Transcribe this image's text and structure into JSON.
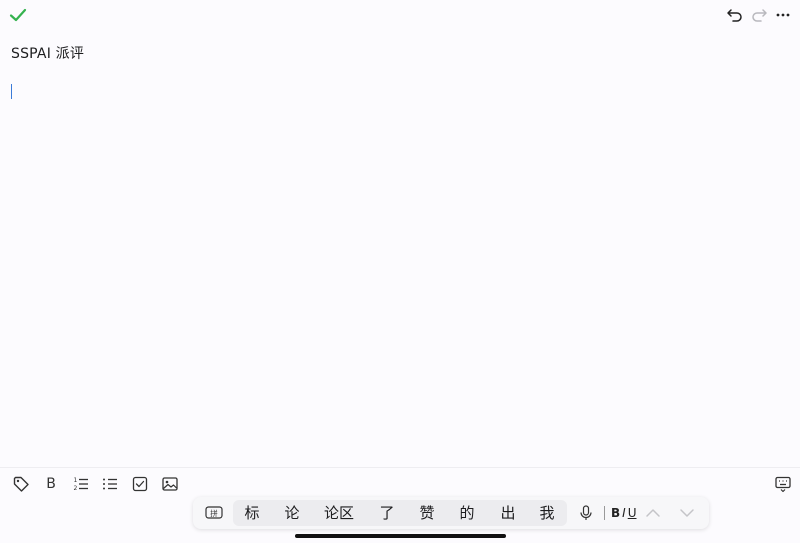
{
  "note": {
    "title": "SSPAI 派评",
    "body": ""
  },
  "toolbar_top": {
    "done_icon": "checkmark-icon",
    "undo_icon": "undo-icon",
    "redo_icon": "redo-icon",
    "more_icon": "more-icon"
  },
  "format_bar": {
    "tag_icon": "tag-icon",
    "bold_label": "B",
    "numbered_list_icon": "numbered-list-icon",
    "bullet_list_icon": "bullet-list-icon",
    "checkbox_icon": "checkbox-icon",
    "image_icon": "image-icon",
    "keyboard_toggle_icon": "keyboard-toggle-icon"
  },
  "ime": {
    "mode_label": "拼",
    "candidates": [
      "标",
      "论",
      "论区",
      "了",
      "赞",
      "的",
      "出",
      "我"
    ],
    "style_b": "B",
    "style_i": "I",
    "style_u": "U"
  },
  "colors": {
    "accent_green": "#35b24f",
    "caret_blue": "#3b7bd8",
    "background": "#fcfbfe"
  }
}
